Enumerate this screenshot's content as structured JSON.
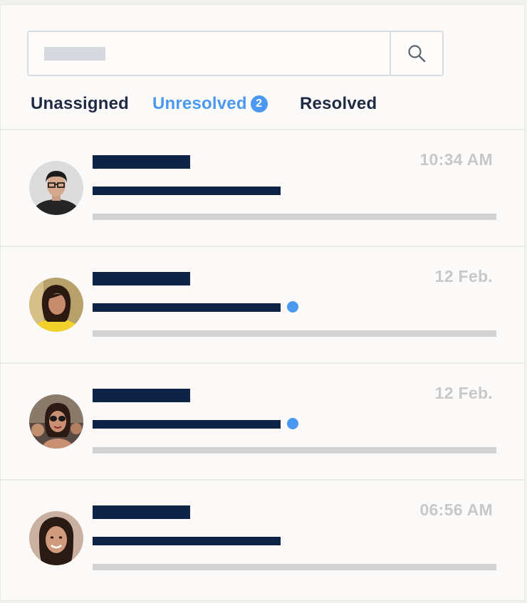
{
  "tabs": [
    {
      "label": "Unassigned"
    },
    {
      "label": "Unresolved",
      "badge": "2"
    },
    {
      "label": "Resolved"
    }
  ],
  "search": {
    "icon": "search-icon"
  },
  "conversations": [
    {
      "time": "10:34 AM",
      "unread": false
    },
    {
      "time": "12 Feb.",
      "unread": true
    },
    {
      "time": "12 Feb.",
      "unread": true
    },
    {
      "time": "06:56 AM",
      "unread": false
    }
  ],
  "colors": {
    "accent": "#4a98f0",
    "navy": "#0e2345",
    "muted": "#c8c8c8"
  }
}
